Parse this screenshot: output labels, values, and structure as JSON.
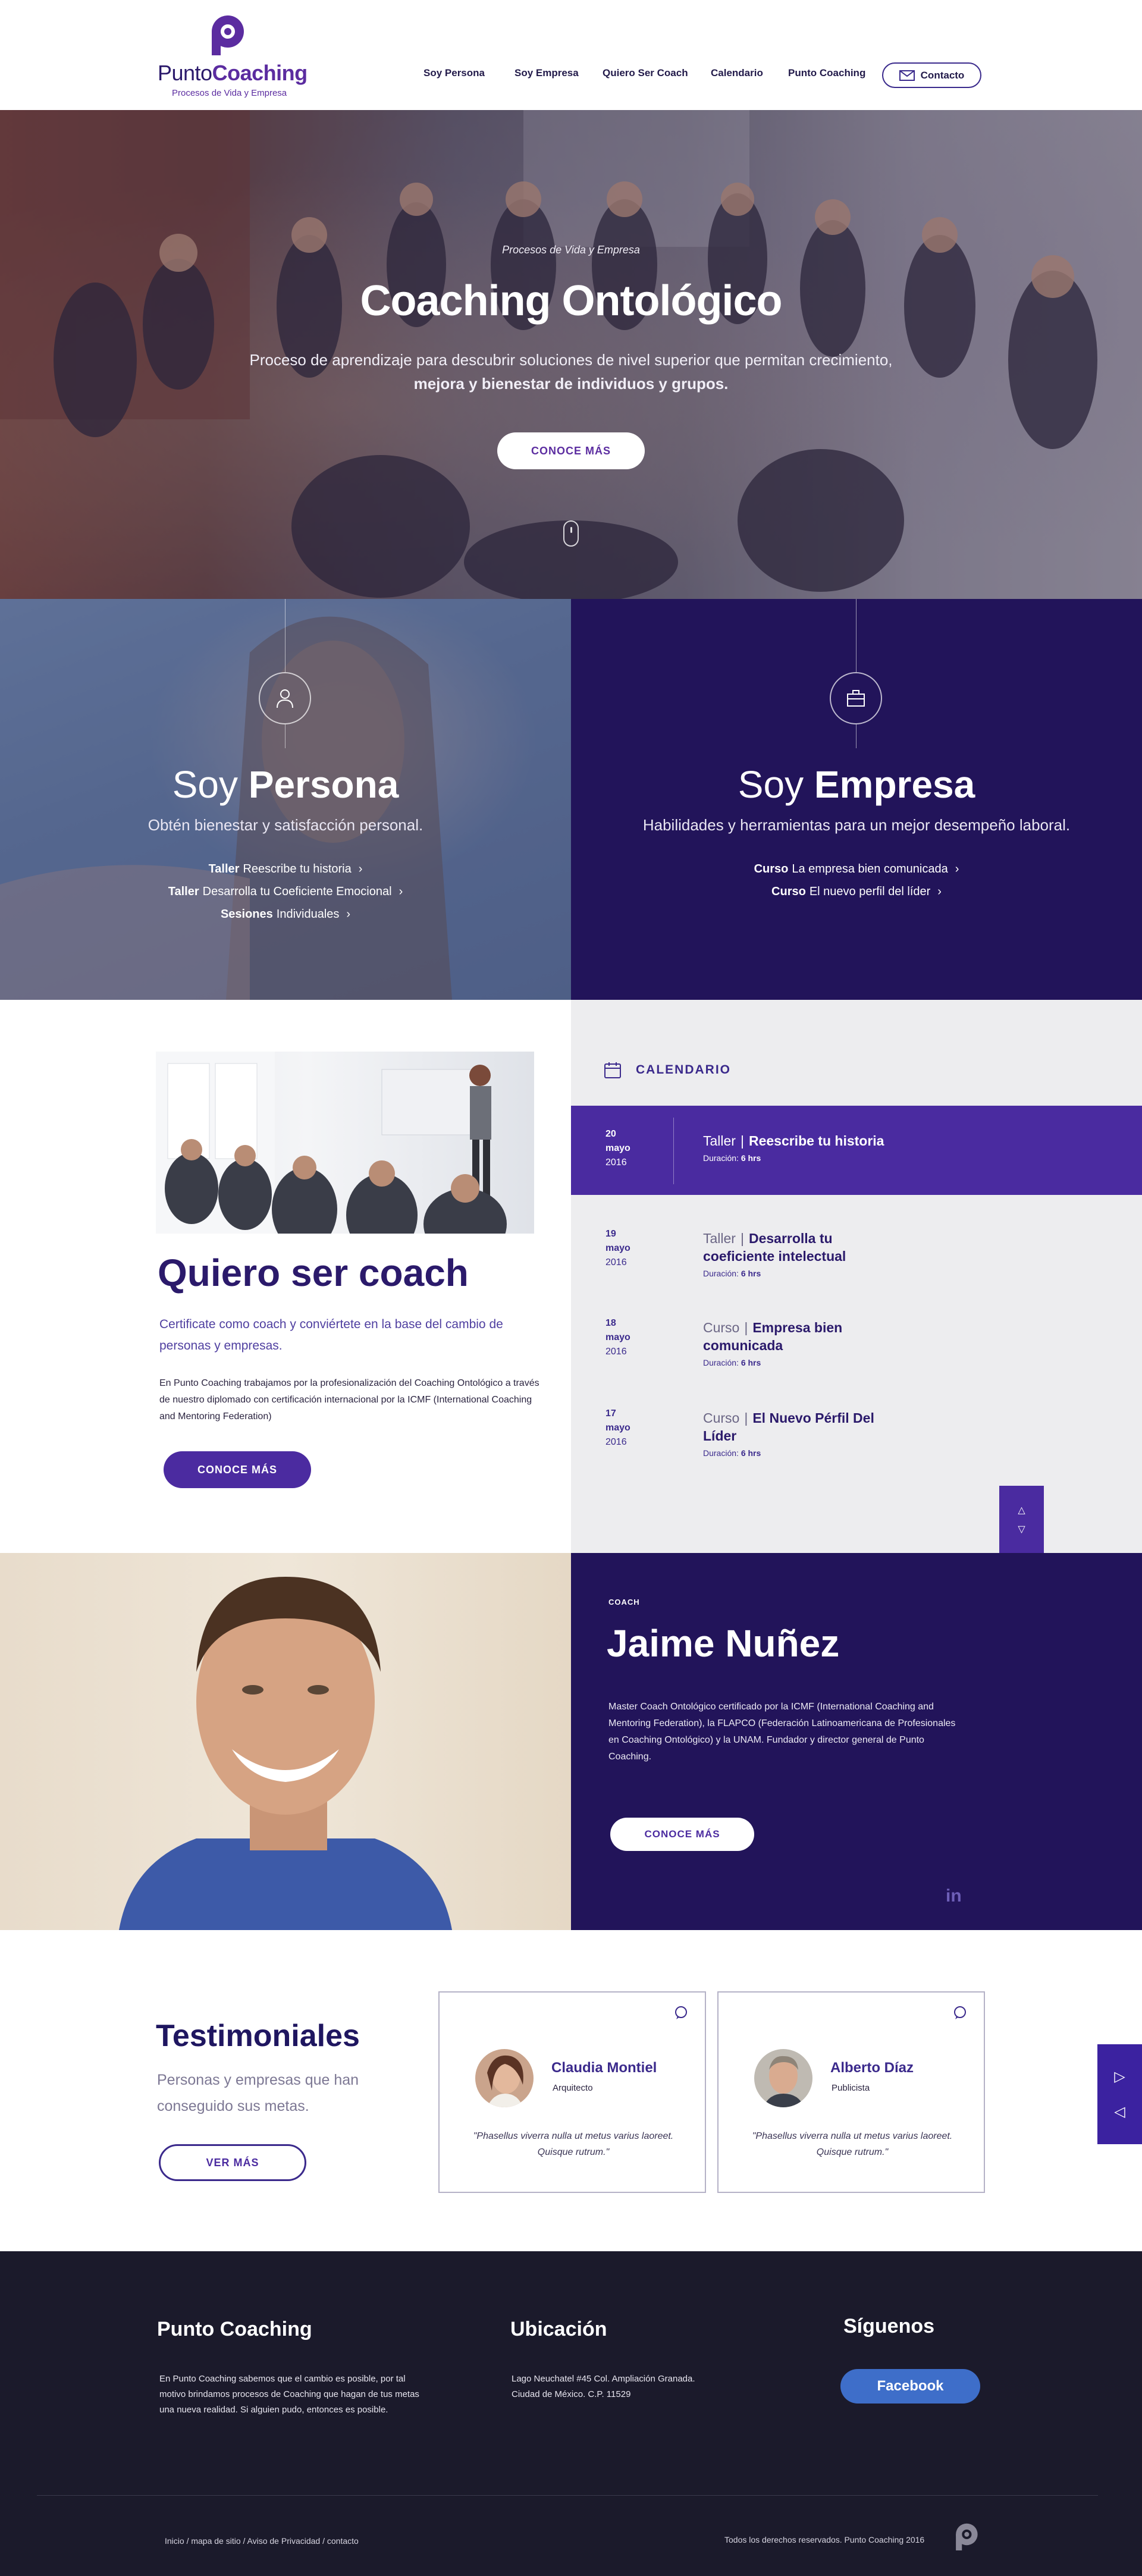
{
  "brand": {
    "name_part1": "Punto",
    "name_part2": "Coaching",
    "tagline": "Procesos de Vida y Empresa",
    "primary_color": "#4b2ba0",
    "dark_color": "#22145a"
  },
  "nav": {
    "items": [
      "Soy Persona",
      "Soy Empresa",
      "Quiero Ser Coach",
      "Calendario",
      "Punto Coaching"
    ],
    "contact_label": "Contacto"
  },
  "hero": {
    "kicker": "Procesos de Vida y Empresa",
    "title": "Coaching Ontológico",
    "desc_line1": "Proceso de aprendizaje para descubrir soluciones de nivel superior que permitan crecimiento,",
    "desc_line2": "mejora y bienestar de individuos y grupos.",
    "cta": "CONOCE MÁS"
  },
  "persona": {
    "title_light": "Soy ",
    "title_bold": "Persona",
    "subtitle": "Obtén bienestar y satisfacción personal.",
    "links": [
      {
        "type": "Taller",
        "text": "Reescribe tu historia"
      },
      {
        "type": "Taller",
        "text": "Desarrolla tu Coeficiente Emocional"
      },
      {
        "type": "Sesiones",
        "text": "Individuales"
      }
    ]
  },
  "empresa": {
    "title_light": "Soy ",
    "title_bold": "Empresa",
    "subtitle": "Habilidades y herramientas para un mejor desempeño laboral.",
    "links": [
      {
        "type": "Curso",
        "text": "La empresa bien comunicada"
      },
      {
        "type": "Curso",
        "text": "El nuevo perfil del líder"
      }
    ]
  },
  "coach": {
    "title_light": "Quiero ser ",
    "title_bold": "coach",
    "lead": "Certificate como coach y conviértete en la base del cambio de personas y empresas.",
    "body": "En Punto Coaching trabajamos por la profesionalización del Coaching Ontológico a través de nuestro diplomado con certificación internacional por la ICMF (International Coaching and Mentoring Federation)",
    "cta": "CONOCE MÁS"
  },
  "calendar": {
    "heading": "CALENDARIO",
    "duration_label": "Duración:",
    "items": [
      {
        "day": "20",
        "month": "mayo",
        "year": "2016",
        "type": "Taller",
        "title": "Reescribe tu historia",
        "duration": "6 hrs"
      },
      {
        "day": "19",
        "month": "mayo",
        "year": "2016",
        "type": "Taller",
        "title": "Desarrolla tu coeficiente intelectual",
        "duration": "6 hrs"
      },
      {
        "day": "18",
        "month": "mayo",
        "year": "2016",
        "type": "Curso",
        "title": "Empresa bien comunicada",
        "duration": "6 hrs"
      },
      {
        "day": "17",
        "month": "mayo",
        "year": "2016",
        "type": "Curso",
        "title": "El Nuevo Pérfil Del Líder",
        "duration": "6 hrs"
      }
    ]
  },
  "jaime": {
    "kicker": "COACH",
    "name_light": "Jaime ",
    "name_bold": "Nuñez",
    "bio": "Master Coach Ontológico certificado por la ICMF (International Coaching and Mentoring Federation), la FLAPCO (Federación Latinoamericana de Profesionales en Coaching Ontológico) y la UNAM. Fundador y director general de Punto Coaching.",
    "cta": "CONOCE MÁS",
    "social": "in"
  },
  "testimonials": {
    "title": "Testimoniales",
    "subtitle": "Personas y empresas que han conseguido sus metas.",
    "cta": "VER MÁS",
    "cards": [
      {
        "name": "Claudia Montiel",
        "role": "Arquitecto",
        "quote": "\"Phasellus viverra nulla ut metus varius laoreet. Quisque rutrum.\""
      },
      {
        "name": "Alberto Díaz",
        "role": "Publicista",
        "quote": "\"Phasellus viverra nulla ut metus varius laoreet. Quisque rutrum.\""
      }
    ]
  },
  "footer": {
    "col1_title": "Punto Coaching",
    "col1_text": "En Punto Coaching sabemos que el cambio es posible, por tal motivo brindamos procesos de Coaching que hagan de tus metas una nueva realidad. Si alguien pudo, entonces es posible.",
    "col2_title": "Ubicación",
    "col2_line1": "Lago Neuchatel #45 Col. Ampliación Granada.",
    "col2_line2": "Ciudad de México. C.P. 11529",
    "col3_title": "Síguenos",
    "facebook": "Facebook",
    "links": "Inicio / mapa de sitio / Aviso de Privacidad / contacto",
    "copyright": "Todos los derechos reservados. Punto Coaching 2016"
  }
}
